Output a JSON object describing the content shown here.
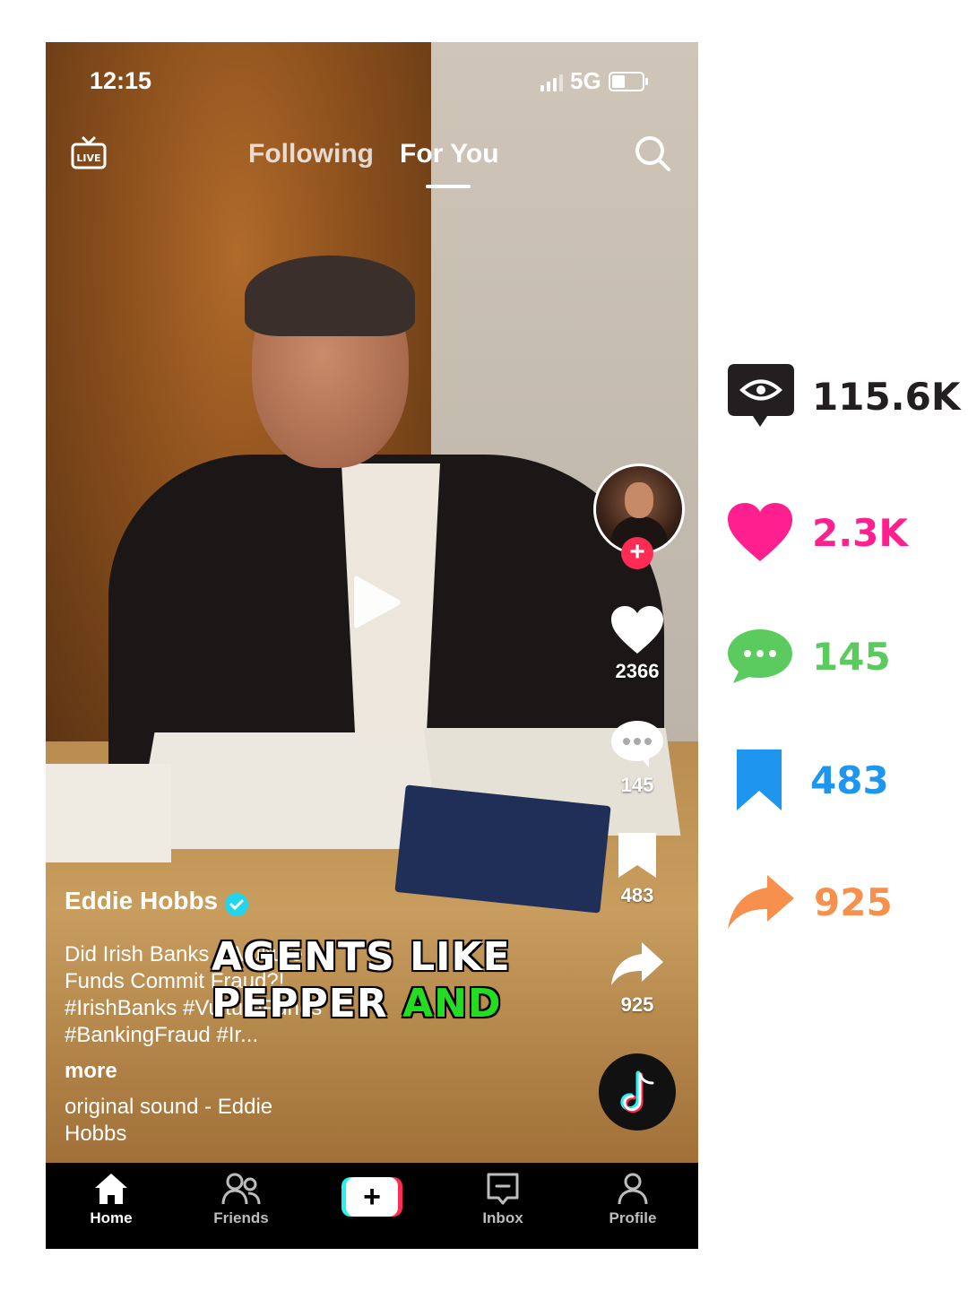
{
  "status_bar": {
    "time": "12:15",
    "network": "5G"
  },
  "top_nav": {
    "live_label": "LIVE",
    "tabs": [
      {
        "label": "Following"
      },
      {
        "label": "For You"
      }
    ],
    "active_tab": "For You"
  },
  "video": {
    "author": "Eddie Hobbs",
    "caption_lines": [
      "Did Irish Banks & Vulture",
      "Funds Commit Fraud?!",
      "#IrishBanks #VultureFunds",
      "#BankingFraud #Ir..."
    ],
    "more_label": "more",
    "sound_label": "original sound - Eddie Hobbs",
    "overlay_line1": "AGENTS LIKE",
    "overlay_line2_white": "PEPPER ",
    "overlay_line2_green": "AND"
  },
  "side_actions": {
    "likes": "2366",
    "comments": "145",
    "saves": "483",
    "shares": "925"
  },
  "bottom_nav": [
    {
      "label": "Home",
      "icon": "home-icon"
    },
    {
      "label": "Friends",
      "icon": "friends-icon"
    },
    {
      "label": "",
      "icon": "plus-icon"
    },
    {
      "label": "Inbox",
      "icon": "inbox-icon"
    },
    {
      "label": "Profile",
      "icon": "profile-icon"
    }
  ],
  "stats_panel": {
    "views": "115.6K",
    "likes": "2.3K",
    "comments": "145",
    "saves": "483",
    "shares": "925",
    "colors": {
      "views": "#231f20",
      "likes": "#ff1f8e",
      "comments": "#5ccb5f",
      "saves": "#1e96f0",
      "shares": "#f7904c"
    }
  }
}
